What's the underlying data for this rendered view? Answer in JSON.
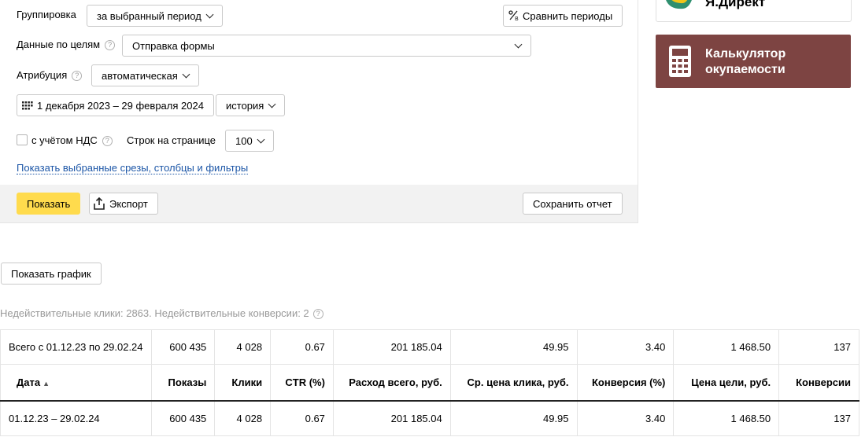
{
  "filters": {
    "grouping_label": "Группировка",
    "grouping_value": "за выбранный период",
    "compare_label": "Сравнить периоды",
    "goals_label": "Данные по целям",
    "goals_value": "Отправка формы",
    "attribution_label": "Атрибуция",
    "attribution_value": "автоматическая",
    "date_range": "1 декабря 2023 – 29 февраля 2024",
    "history_value": "история",
    "vat_label": "с учётом НДС",
    "vat_checked": false,
    "rows_label": "Строк на странице",
    "rows_value": "100",
    "show_slices_link": "Показать выбранные срезы, столбцы и фильтры"
  },
  "actions": {
    "show": "Показать",
    "export": "Экспорт",
    "save_report": "Сохранить отчет",
    "show_chart": "Показать график"
  },
  "promo": {
    "direct_title": "Я.Директ",
    "calculator_title": "Калькулятор\nокупаемости",
    "calculator_color": "#7d4442"
  },
  "note": "Недействительные клики: 2863. Недействительные конверсии: 2",
  "table": {
    "total": [
      "Всего с 01.12.23 по 29.02.24",
      "600 435",
      "4 028",
      "0.67",
      "201 185.04",
      "49.95",
      "3.40",
      "1 468.50",
      "137"
    ],
    "headers": [
      "Дата",
      "Показы",
      "Клики",
      "CTR (%)",
      "Расход всего, руб.",
      "Ср. цена клика, руб.",
      "Конверсия (%)",
      "Цена цели, руб.",
      "Конверсии"
    ],
    "sort_indicator": "▲",
    "rows": [
      [
        "01.12.23 – 29.02.24",
        "600 435",
        "4 028",
        "0.67",
        "201 185.04",
        "49.95",
        "3.40",
        "1 468.50",
        "137"
      ]
    ]
  },
  "colors": {
    "accent_yellow": "#ffdb4d",
    "link_blue": "#1c56a7"
  }
}
